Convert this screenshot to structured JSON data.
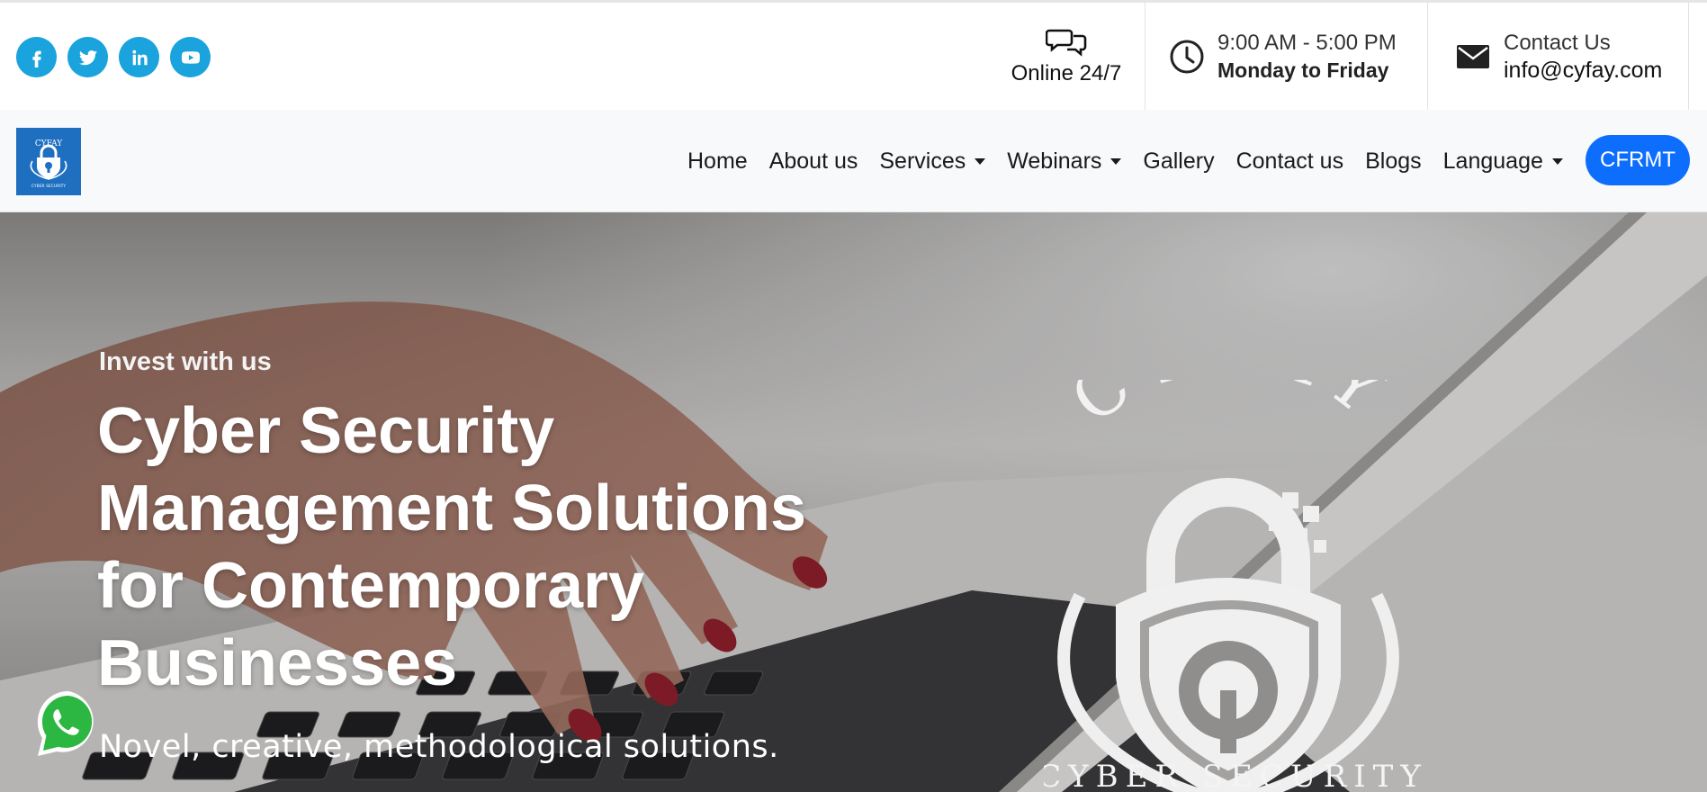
{
  "topbar": {
    "social": [
      {
        "icon": "facebook-icon"
      },
      {
        "icon": "twitter-icon"
      },
      {
        "icon": "linkedin-icon"
      },
      {
        "icon": "youtube-icon"
      }
    ],
    "online": {
      "icon": "chat-bubbles-icon",
      "label": "Online 24/7"
    },
    "hours": {
      "icon": "clock-icon",
      "time": "9:00 AM - 5:00 PM",
      "days": "Monday to Friday"
    },
    "contact": {
      "icon": "envelope-icon",
      "label": "Contact Us",
      "email": "info@cyfay.com"
    }
  },
  "navbar": {
    "logo": {
      "text_top": "CYFAY",
      "text_bottom": "CYBER SECURITY"
    },
    "items": [
      {
        "label": "Home",
        "dropdown": false
      },
      {
        "label": "About us",
        "dropdown": false
      },
      {
        "label": "Services",
        "dropdown": true
      },
      {
        "label": "Webinars",
        "dropdown": true
      },
      {
        "label": "Gallery",
        "dropdown": false
      },
      {
        "label": "Contact us",
        "dropdown": false
      },
      {
        "label": "Blogs",
        "dropdown": false
      },
      {
        "label": "Language",
        "dropdown": true
      }
    ],
    "cta_label": "CFRMT"
  },
  "hero": {
    "eyebrow": "Invest with us",
    "headline_lines": [
      "Cyber Security",
      "Management Solutions",
      "for Contemporary",
      "Businesses"
    ],
    "tagline": "Novel, creative, methodological solutions.",
    "brand_top": "CYFAY",
    "brand_bottom": "CYBER SECURITY",
    "whatsapp_icon": "whatsapp-icon"
  },
  "colors": {
    "social": "#1aa3dc",
    "cta": "#0d6efd",
    "logo_bg": "#1e6fc0"
  }
}
